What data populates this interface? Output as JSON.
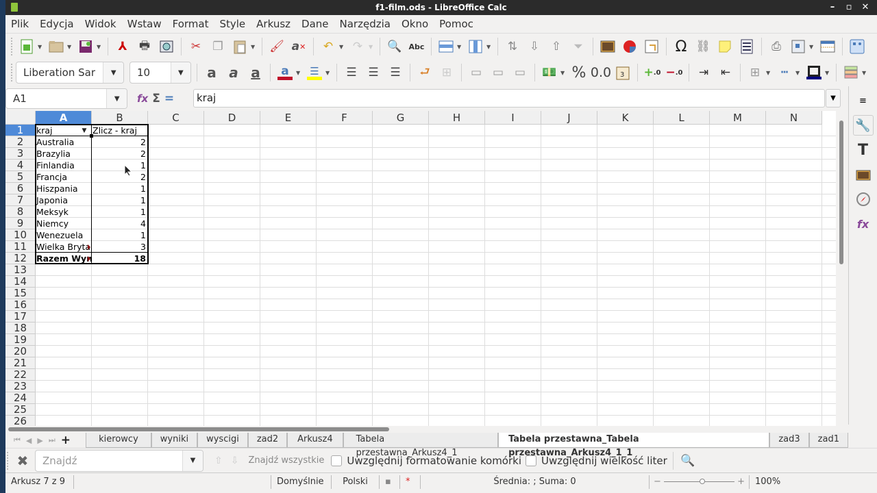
{
  "window": {
    "title": "f1-film.ods - LibreOffice Calc",
    "controls": [
      "–",
      "▫",
      "✕"
    ]
  },
  "menu": [
    "Plik",
    "Edycja",
    "Widok",
    "Wstaw",
    "Format",
    "Style",
    "Arkusz",
    "Dane",
    "Narzędzia",
    "Okno",
    "Pomoc"
  ],
  "formatting": {
    "font_name": "Liberation Sar",
    "font_size": "10"
  },
  "colors": {
    "font_color": "#c0102a",
    "highlight_color": "#ffff00",
    "border_color": "#00007f",
    "selection": "#4e8ad8"
  },
  "formula_bar": {
    "name_box": "A1",
    "content": "kraj"
  },
  "columns": [
    "A",
    "B",
    "C",
    "D",
    "E",
    "F",
    "G",
    "H",
    "I",
    "J",
    "K",
    "L",
    "M",
    "N"
  ],
  "rows": [
    "1",
    "2",
    "3",
    "4",
    "5",
    "6",
    "7",
    "8",
    "9",
    "10",
    "11",
    "12",
    "13",
    "14",
    "15",
    "16",
    "17",
    "18",
    "19",
    "20",
    "21",
    "22",
    "23",
    "24",
    "25",
    "26"
  ],
  "pivot": {
    "header": {
      "a": "kraj",
      "b": "Zlicz - kraj"
    },
    "data": [
      {
        "a": "Australia",
        "b": "2"
      },
      {
        "a": "Brazylia",
        "b": "2"
      },
      {
        "a": "Finlandia",
        "b": "1"
      },
      {
        "a": "Francja",
        "b": "2"
      },
      {
        "a": "Hiszpania",
        "b": "1"
      },
      {
        "a": "Japonia",
        "b": "1"
      },
      {
        "a": "Meksyk",
        "b": "1"
      },
      {
        "a": "Niemcy",
        "b": "4"
      },
      {
        "a": "Wenezuela",
        "b": "1"
      },
      {
        "a": "Wielka Brytania",
        "b": "3"
      }
    ],
    "total": {
      "a": "Razem Wynik",
      "b": "18"
    }
  },
  "sheet_tabs": [
    "kierowcy",
    "wyniki",
    "wyscigi",
    "zad2",
    "Arkusz4",
    "Tabela przestawna_Arkusz4_1",
    "Tabela przestawna_Tabela przestawna_Arkusz4_1_1",
    "zad3",
    "zad1"
  ],
  "active_tab": "Tabela przestawna_Tabela przestawna_Arkusz4_1_1",
  "find_bar": {
    "placeholder": "Znajdź",
    "find_all": "Znajdź wszystkie",
    "match_formatting": "Uwzględnij formatowanie komórki",
    "match_case": "Uwzględnij wielkość liter"
  },
  "status_bar": {
    "sheet": "Arkusz 7 z 9",
    "page_style": "Domyślnie",
    "language": "Polski",
    "summary": "Średnia: ; Suma: 0",
    "zoom": "100%"
  }
}
